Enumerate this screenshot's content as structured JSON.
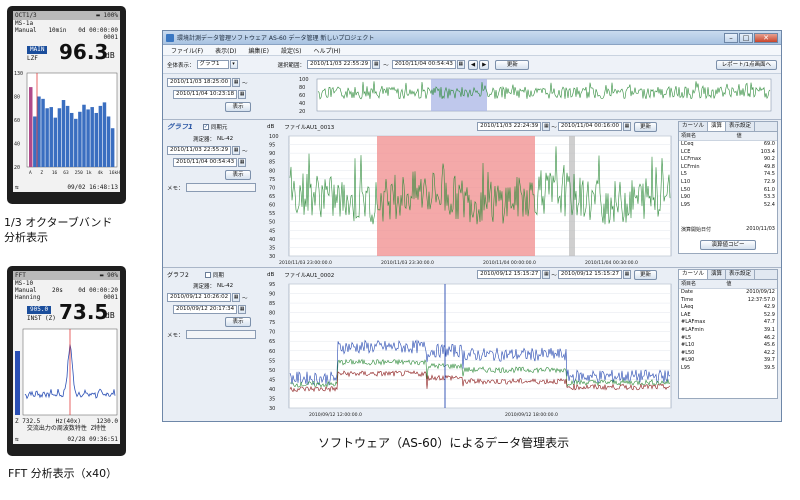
{
  "device1": {
    "status_left": "OCT1/3",
    "status_right": "100%",
    "line1_left": "MS-1a",
    "line1_right": "",
    "line2_left": "Manual",
    "line2_mid": "10min",
    "line2_right": "0d 00:00:00",
    "line3_right": "0001",
    "mode_tag": "MAIN",
    "mode_sub": "LZF",
    "reading": "96.3",
    "unit": "dB",
    "y_labels": [
      "130",
      "80",
      "60",
      "40",
      "20"
    ],
    "x_labels": [
      "A",
      "Z",
      "16",
      "63",
      "250",
      "1k",
      "4k",
      "16kHz"
    ],
    "bar_values": [
      88,
      63,
      80,
      78,
      70,
      71,
      62,
      70,
      77,
      72,
      66,
      61,
      67,
      73,
      69,
      71,
      66,
      72,
      75,
      63,
      53
    ],
    "footer_right": "09/02 16:48:13",
    "bar_color": "#3a6ec0",
    "ref_bar_color": "#b04a8a"
  },
  "caption1": {
    "line1": "1/3 オクターブバンド",
    "line2": "分析表示"
  },
  "device2": {
    "status_left": "FFT",
    "status_right": "90%",
    "line1_left": "MS-10",
    "line2_left": "Manual",
    "line2_mid": "20s",
    "line2_right": "0d 00:00:20",
    "line3_left": "Hanning",
    "line3_right": "0001",
    "mode_tag": "905.0",
    "mode_sub": "INST (Z)",
    "reading": "73.5",
    "unit": "dB",
    "x_bottom_left": "Z 732.5",
    "x_bottom_mid": "Hz(40x)",
    "x_bottom_right": "1230.0",
    "info_line": "交流出力の周波数特性 Z特性",
    "footer_right": "02/28 09:36:51"
  },
  "caption2": {
    "text": "FFT 分析表示（x40）"
  },
  "caption_main": {
    "text": "ソフトウェア（AS-60）によるデータ管理表示"
  },
  "window": {
    "title": "環境計測データ管理ソフトウェア AS-60 データ管理 新しいプロジェクト",
    "menu": [
      "ファイル(F)",
      "表示(D)",
      "編集(E)",
      "設定(S)",
      "ヘルプ(H)"
    ],
    "toolbar": {
      "display_label": "全体表示：",
      "display_value": "グラフ1",
      "range_label": "選択範囲：",
      "range_start": "2010/11/03 22:55:29",
      "range_sep": "〜",
      "range_end": "2010/11/04 00:54:43",
      "update": "更新",
      "report": "レポート/1点画面へ"
    },
    "overview": {
      "start": "2010/11/03 18:25:00",
      "end": "2010/11/04 10:23:18",
      "display": "表示",
      "y_ticks": [
        "100",
        "80",
        "60",
        "40",
        "20"
      ]
    },
    "graph1": {
      "title": "グラフ1",
      "sync": "同期元",
      "device_label": "測定器：",
      "device": "NL-42",
      "start": "2010/11/03 22:55:29",
      "end": "2010/11/04 00:54:43",
      "display": "表示",
      "memo": "メモ：",
      "db": "dB",
      "file": "ファイルAU1_0013",
      "plot_start": "2010/11/03 22:24:39",
      "plot_end": "2010/11/04 00:16:00",
      "update": "更新",
      "y_ticks": [
        "100",
        "95",
        "90",
        "85",
        "80",
        "75",
        "70",
        "65",
        "60",
        "55",
        "50",
        "45",
        "40",
        "35",
        "30"
      ],
      "x_ticks": [
        "2010/11/03 23:00:00.0",
        "2010/11/03 23:30:00.0",
        "2010/11/04 00:00:00.0",
        "2010/11/04 00:30:00.0"
      ],
      "tabs": [
        "カーソル",
        "演算",
        "表示設定"
      ],
      "col_item": "項目名",
      "col_value": "値",
      "rows": [
        [
          "LCeq",
          "69.0"
        ],
        [
          "LCE",
          "103.4"
        ],
        [
          "LCFmax",
          "90.2"
        ],
        [
          "LCFmin",
          "49.8"
        ],
        [
          "L5",
          "74.5"
        ],
        [
          "L10",
          "72.9"
        ],
        [
          "L50",
          "61.0"
        ],
        [
          "L90",
          "53.3"
        ],
        [
          "L95",
          "52.4"
        ]
      ],
      "calc_start_label": "演算開始日付",
      "calc_start_value": "2010/11/03",
      "calc_copy": "演算値コピー",
      "line_color": "#2e8b3a",
      "highlight_color": "#f08c8c"
    },
    "graph2": {
      "title": "グラフ2",
      "sync": "同期",
      "device_label": "測定器：",
      "device": "NL-42",
      "start": "2010/09/12 10:26:02",
      "end": "2010/09/12 20:17:34",
      "display": "表示",
      "memo": "メモ：",
      "db": "dB",
      "file": "ファイルAU1_0002",
      "plot_start": "2010/09/12 15:15:27",
      "plot_end": "2010/09/12 15:15:27",
      "update": "更新",
      "y_ticks": [
        "95",
        "90",
        "85",
        "80",
        "75",
        "70",
        "65",
        "60",
        "55",
        "50",
        "45",
        "40",
        "35",
        "30"
      ],
      "x_ticks": [
        "2010/09/12 12:00:00.0",
        "2010/09/12 18:00:00.0"
      ],
      "tabs": [
        "カーソル",
        "演算",
        "表示設定"
      ],
      "col_item": "項目名",
      "col_value": "値",
      "rows": [
        [
          "Date",
          "2010/09/12"
        ],
        [
          "Time",
          "12:37:57.0"
        ],
        [
          "LAeq",
          "42.9"
        ],
        [
          "LAE",
          "52.9"
        ],
        [
          "#LAFmax",
          "47.7"
        ],
        [
          "#LAFmin",
          "39.1"
        ],
        [
          "#L5",
          "46.2"
        ],
        [
          "#L10",
          "45.6"
        ],
        [
          "#L50",
          "42.2"
        ],
        [
          "#L90",
          "39.7"
        ],
        [
          "L95",
          "39.5"
        ]
      ],
      "series_colors": [
        "#2447b0",
        "#2e8b3a",
        "#8b1a1a"
      ]
    }
  }
}
